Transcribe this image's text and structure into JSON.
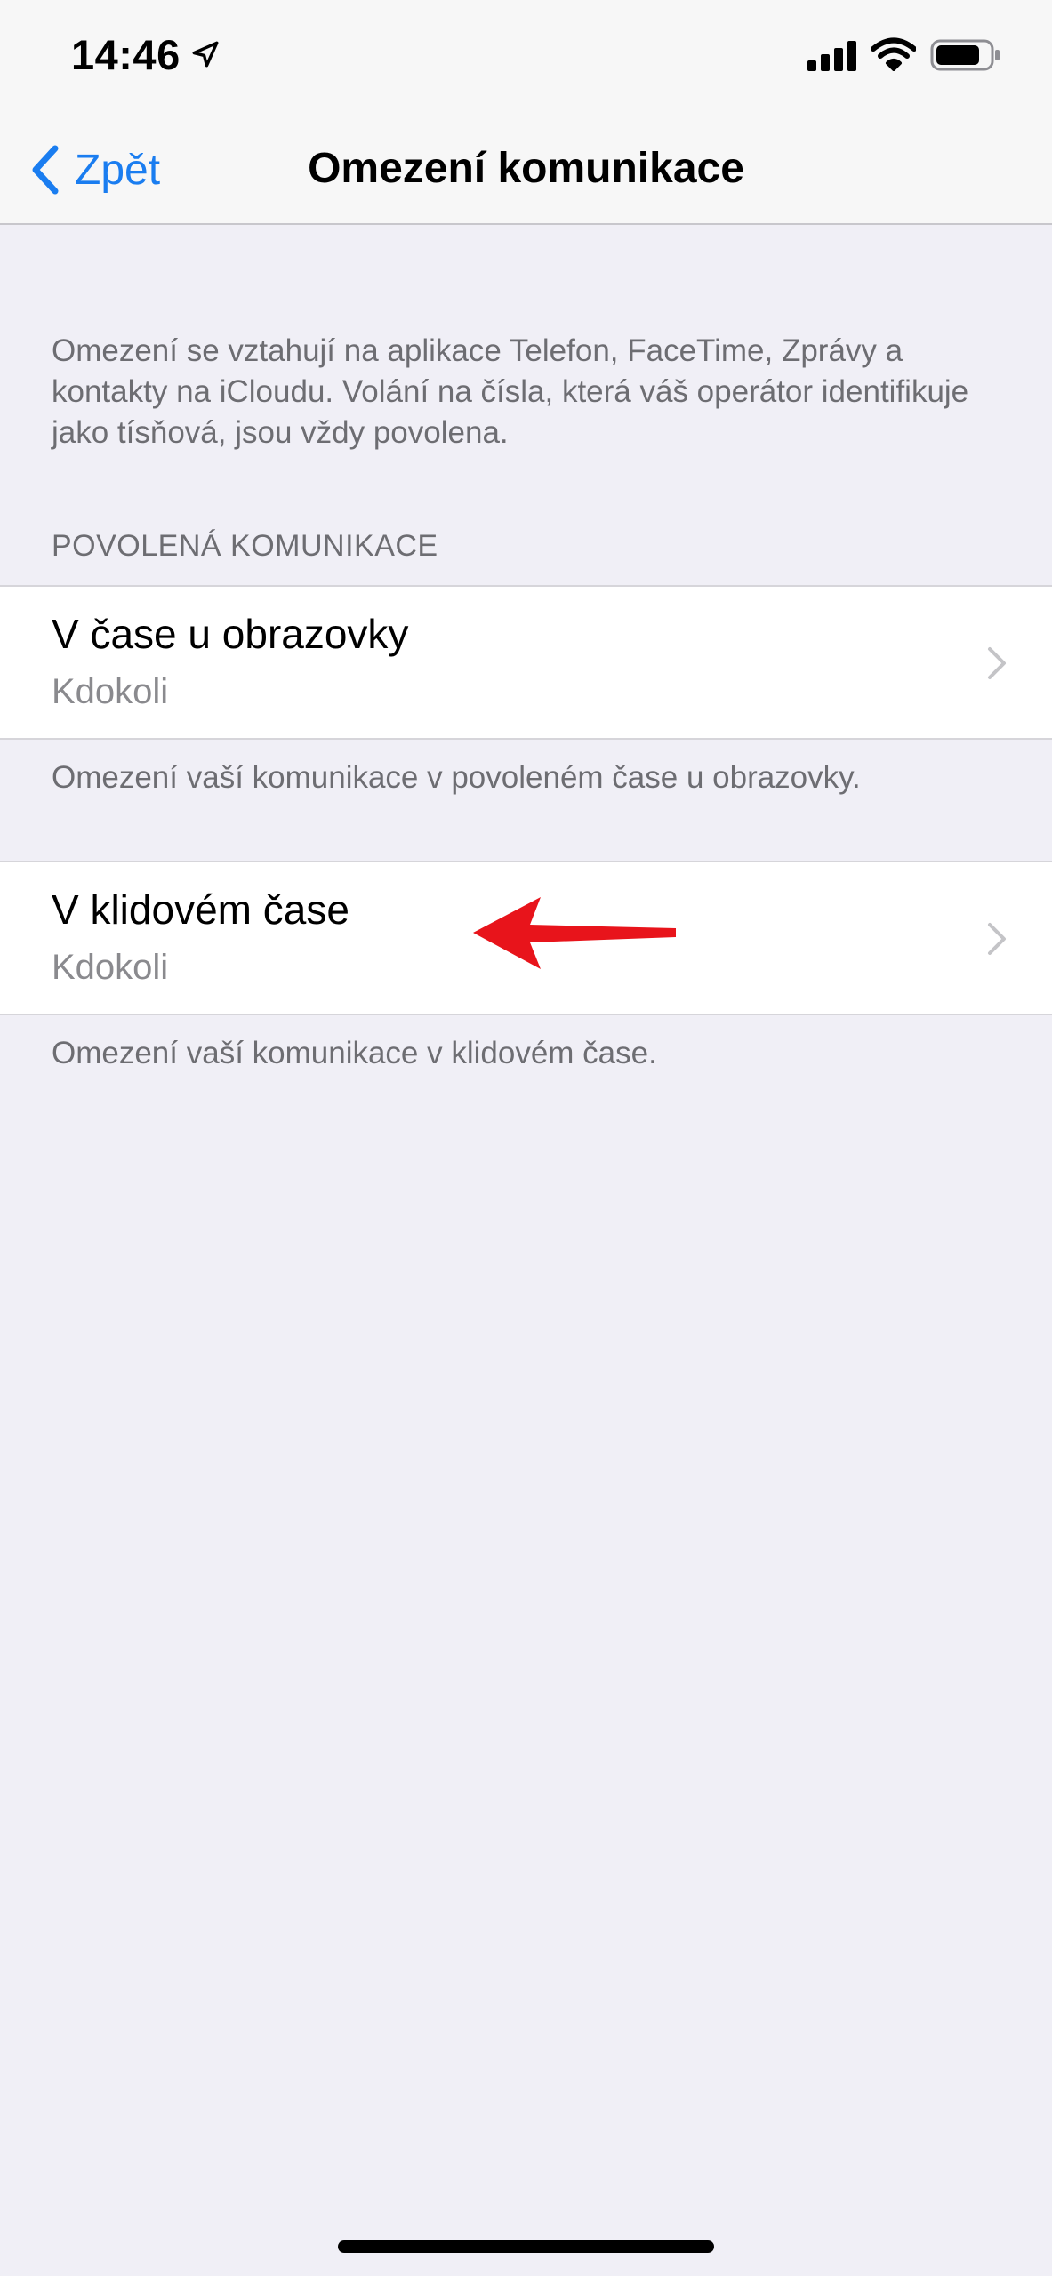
{
  "status_bar": {
    "time": "14:46",
    "icons": [
      "location-arrow-icon",
      "cellular-signal-icon",
      "wifi-icon",
      "battery-icon"
    ]
  },
  "nav": {
    "back_label": "Zpět",
    "title": "Omezení komunikace",
    "accent_color": "#1a7df0"
  },
  "intro": {
    "text": "Omezení se vztahují na aplikace Telefon, FaceTime, Zprávy a kontakty na iCloudu. Volání na čísla, která váš operátor identifikuje jako tísňová, jsou vždy povolena."
  },
  "section": {
    "header": "POVOLENÁ KOMUNIKACE",
    "items": [
      {
        "title": "V čase u obrazovky",
        "value": "Kdokoli",
        "footer": "Omezení vaší komunikace v povoleném čase u obrazovky."
      },
      {
        "title": "V klidovém čase",
        "value": "Kdokoli",
        "footer": "Omezení vaší komunikace v klidovém čase."
      }
    ]
  },
  "annotation": {
    "arrow_color": "#e8141b"
  }
}
